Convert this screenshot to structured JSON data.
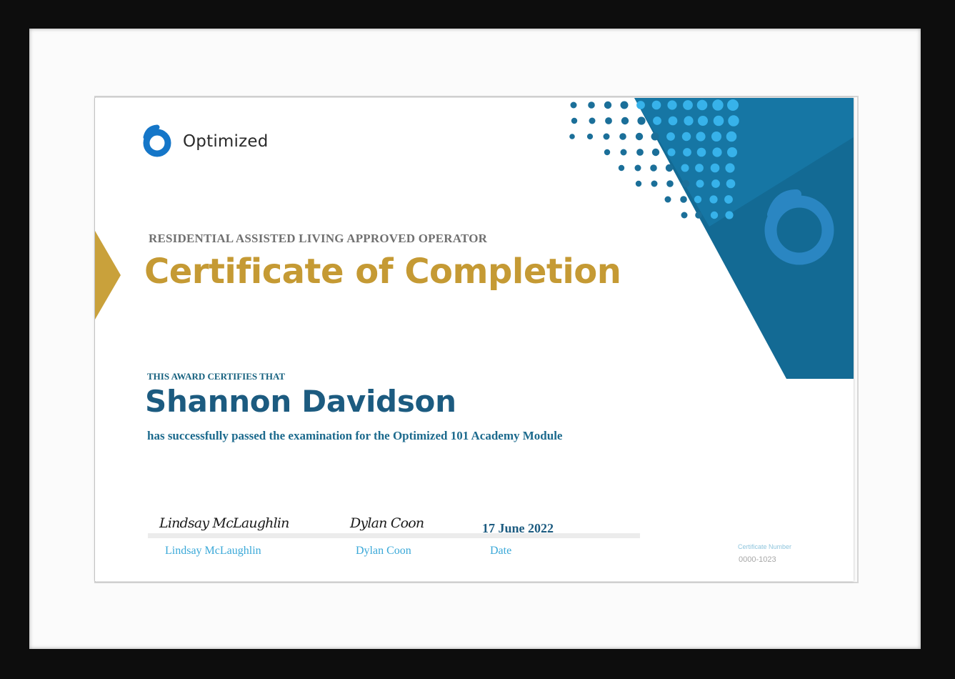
{
  "brand": {
    "name": "Optimized"
  },
  "certificate": {
    "subtitle": "RESIDENTIAL ASSISTED LIVING APPROVED OPERATOR",
    "title": "Certificate of Completion",
    "certifies_text": "THIS AWARD CERTIFIES THAT",
    "recipient": "Shannon Davidson",
    "achievement": "has successfully passed the examination for the Optimized 101 Academy Module",
    "date": "17 June 2022",
    "number_label": "Certificate Number",
    "number": "0000-1023"
  },
  "signatures": [
    {
      "signature": "Lindsay McLaughlin",
      "label": "Lindsay McLaughlin"
    },
    {
      "signature": "Dylan Coon",
      "label": "Dylan Coon"
    }
  ],
  "date_label": "Date",
  "colors": {
    "frame": "#0d0d0d",
    "gold": "#c59a34",
    "navy": "#1c5b80",
    "blue_panel": "#136a94",
    "light_blue": "#3aa8d8"
  }
}
